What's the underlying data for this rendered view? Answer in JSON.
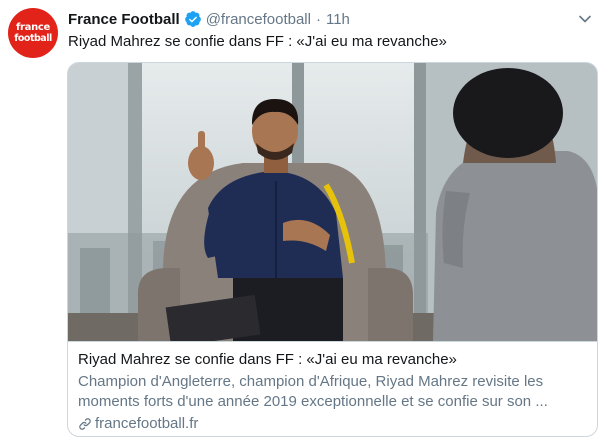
{
  "tweet": {
    "avatar": {
      "line1": "france",
      "line2": "football",
      "bg_color": "#e2231a"
    },
    "author_name": "France Football",
    "verified": true,
    "handle": "@francefootball",
    "separator": "·",
    "time": "11h",
    "text": "Riyad Mahrez se confie dans FF : «J'ai eu ma revanche»",
    "card": {
      "title": "Riyad Mahrez se confie dans FF : «J'ai eu ma revanche»",
      "description": "Champion d'Angleterre, champion d'Afrique, Riyad Mahrez revisite les moments forts d'une année 2019 exceptionnelle et se confie sur son ...",
      "domain": "francefootball.fr",
      "link_icon": "link-icon",
      "image_icon": "interview-photo"
    }
  },
  "colors": {
    "text": "#14171a",
    "secondary": "#657786",
    "border": "#ccd6dd",
    "verified": "#1da1f2",
    "jacket": "#1f2d55",
    "stripe": "#e6c20a"
  }
}
